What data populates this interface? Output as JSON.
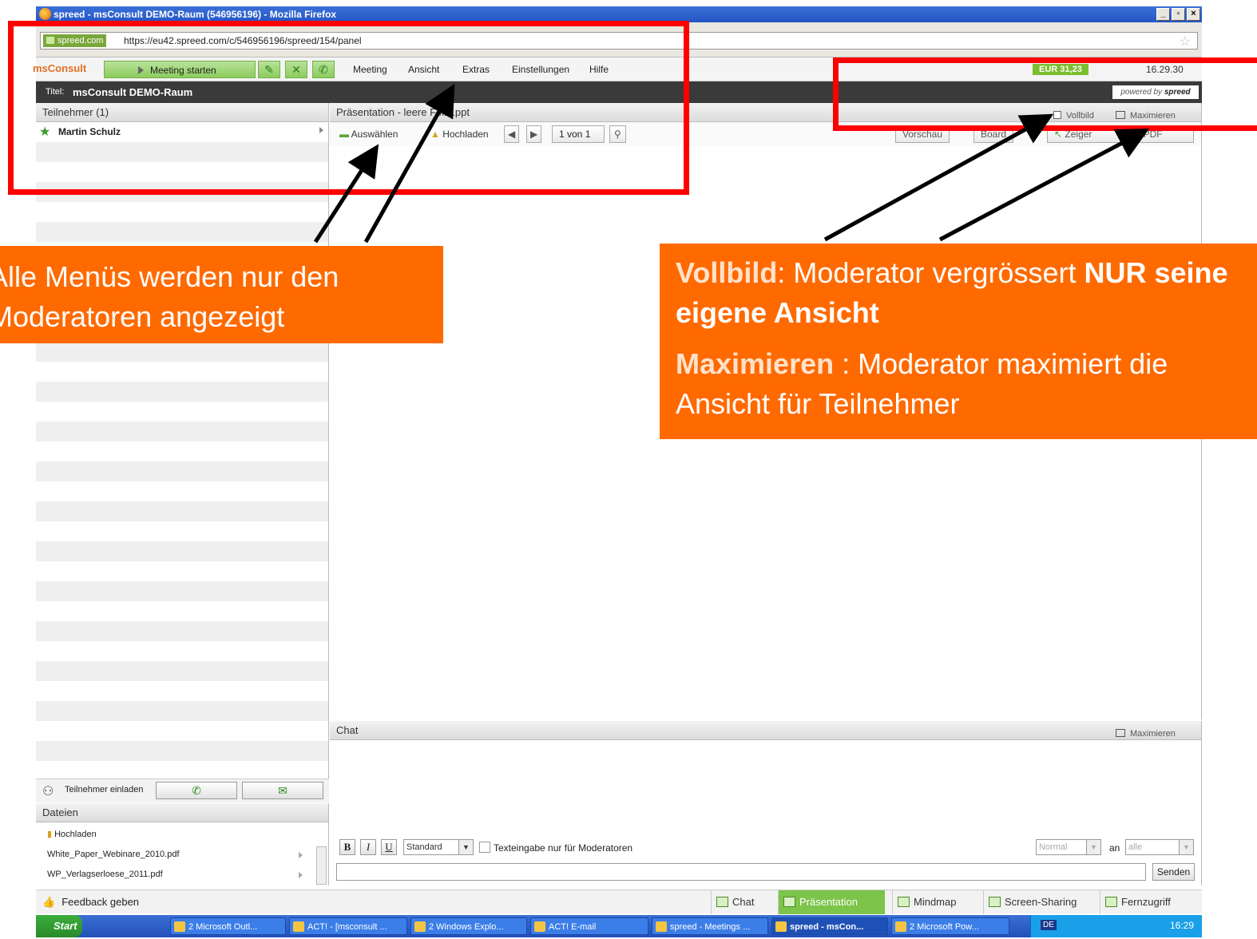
{
  "window": {
    "title": "spreed - msConsult DEMO-Raum (546956196) - Mozilla Firefox",
    "controls": [
      "_",
      "̅",
      "X"
    ]
  },
  "urlbar": {
    "site_badge": "spreed.com",
    "url": "https://eu42.spreed.com/c/546956196/spreed/154/panel"
  },
  "menubar": {
    "logo": "msConsult",
    "start_meeting": "Meeting starten",
    "menus": [
      "Meeting",
      "Ansicht",
      "Extras",
      "Einstellungen",
      "Hilfe"
    ],
    "credit": "EUR 31,23",
    "time": "16.29.30"
  },
  "apptitle": {
    "label": "Titel:",
    "room": "msConsult DEMO-Raum",
    "powered_by": "powered by",
    "brand": "spreed"
  },
  "participants": {
    "header": "Teilnehmer (1)",
    "items": [
      {
        "name": "Martin Schulz",
        "role": "moderator"
      }
    ],
    "invite_label": "Teilnehmer einladen"
  },
  "files": {
    "header": "Dateien",
    "upload": "Hochladen",
    "items": [
      "White_Paper_Webinare_2010.pdf",
      "WP_Verlagserloese_2011.pdf"
    ]
  },
  "presentation": {
    "header": "Präsentation - leere Folie.ppt",
    "fullscreen": "Vollbild",
    "maximize": "Maximieren",
    "select": "Auswählen",
    "upload": "Hochladen",
    "page": "1 von 1",
    "preview": "Vorschau",
    "board": "Board",
    "pointer": "Zeiger",
    "pdf": "PDF"
  },
  "chat": {
    "header": "Chat",
    "maximize": "Maximieren",
    "bold": "B",
    "italic": "I",
    "underline": "U",
    "font": "Standard",
    "moderator_only": "Texteingabe nur für Moderatoren",
    "priority": "Normal",
    "to_label": "an",
    "recipient": "alle",
    "send": "Senden"
  },
  "bottom": {
    "feedback": "Feedback geben",
    "tabs": [
      "Chat",
      "Präsentation",
      "Mindmap",
      "Screen-Sharing",
      "Fernzugriff"
    ],
    "active_tab": "Präsentation"
  },
  "taskbar": {
    "start": "Start",
    "tasks": [
      "2 Microsoft Outl...",
      "ACT! - [msconsult ...",
      "2 Windows Explo...",
      "ACT! E-mail",
      "spreed - Meetings ...",
      "spreed - msCon...",
      "2 Microsoft Pow..."
    ],
    "active_task": "spreed - msCon...",
    "lang": "DE",
    "clock": "16:29"
  },
  "annotations": {
    "left_line1": "Alle Menüs werden nur den",
    "left_line2": "Moderatoren angezeigt",
    "right_term1": "Vollbild",
    "right_text1": ": Moderator vergrössert ",
    "right_bold1": "NUR seine eigene Ansicht",
    "right_term2": "Maximieren",
    "right_text2": " : Moderator maximiert die Ansicht für Teilnehmer"
  },
  "colors": {
    "annotation_red": "#ff0000",
    "callout_orange": "#ff6a00",
    "accent_green": "#7cc44a"
  }
}
